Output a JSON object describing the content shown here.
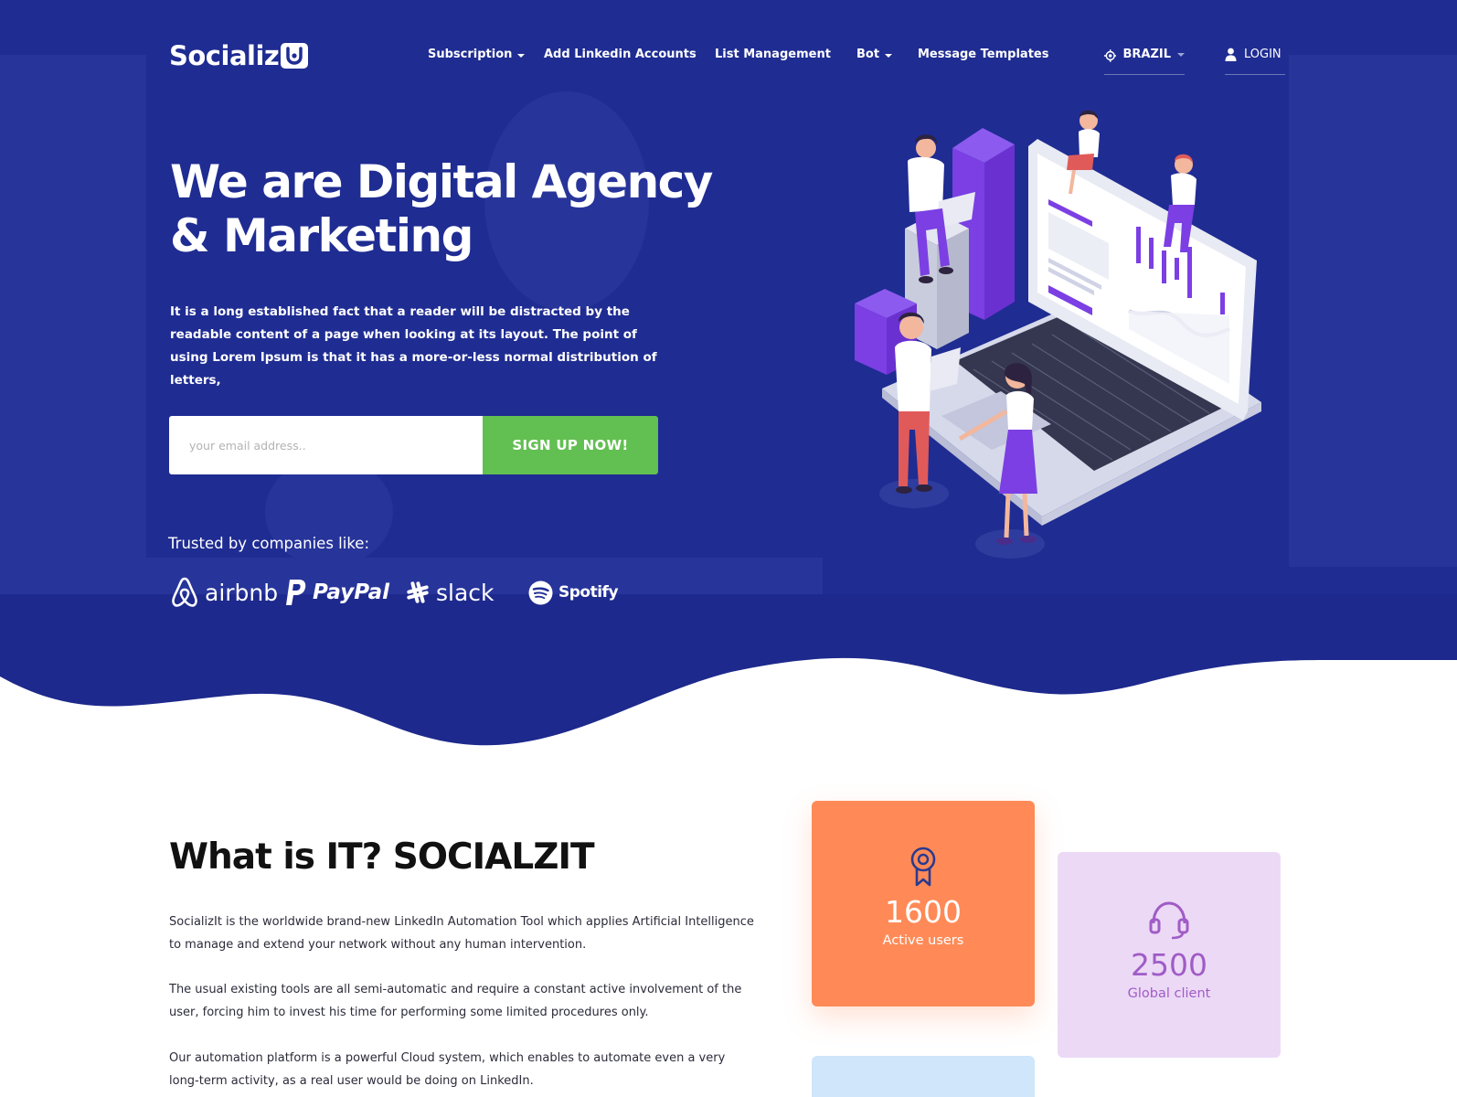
{
  "brand": {
    "name": "Socializ"
  },
  "nav": {
    "items": [
      {
        "label": "Subscription",
        "has_dropdown": true
      },
      {
        "label": "Add Linkedin Accounts",
        "has_dropdown": false
      },
      {
        "label": "List Management",
        "has_dropdown": false
      },
      {
        "label": "Bot",
        "has_dropdown": true
      },
      {
        "label": "Message Templates",
        "has_dropdown": false
      }
    ],
    "country": "BRAZIL",
    "login": "LOGIN"
  },
  "hero": {
    "title_line1": "We are Digital Agency",
    "title_line2": "& Marketing",
    "description": "It is a long established fact that a reader will be distracted by the readable content of a page when looking at its layout. The point of using Lorem Ipsum is that it has a more-or-less normal distribution of letters,",
    "email_placeholder": "your email address..",
    "email_value": "",
    "cta": "SIGN UP NOW!",
    "trusted_label": "Trusted by companies like:",
    "brands": [
      {
        "name": "airbnb",
        "icon": "airbnb-icon"
      },
      {
        "name": "PayPal",
        "icon": "paypal-icon"
      },
      {
        "name": "slack",
        "icon": "slack-icon"
      },
      {
        "name": "Spotify",
        "icon": "spotify-icon"
      }
    ]
  },
  "about": {
    "title": "What is IT? SOCIALZIT",
    "paragraphs": [
      "SocializIt is the worldwide brand-new LinkedIn Automation Tool which applies Artificial Intelligence to manage and extend your network without any human intervention.",
      "The usual existing tools are all semi-automatic and require a constant active involvement of the user, forcing him to invest his time for performing some limited procedures only.",
      "Our automation platform is a powerful Cloud system, which enables to automate even a very long-term activity, as a real user would be doing on LinkedIn."
    ]
  },
  "stats": [
    {
      "value": "1600",
      "label": "Active users",
      "icon": "award-icon",
      "color": "#ff8a57"
    },
    {
      "value": "2500",
      "label": "Global client",
      "icon": "headset-icon",
      "color": "#ecd9f6"
    },
    {
      "value": "",
      "label": "",
      "icon": "",
      "color": "#cfe6fb"
    }
  ],
  "colors": {
    "hero_bg": "#1f2d94",
    "accent_green": "#62bf52",
    "accent_purple": "#7b3fe4",
    "white": "#ffffff"
  }
}
